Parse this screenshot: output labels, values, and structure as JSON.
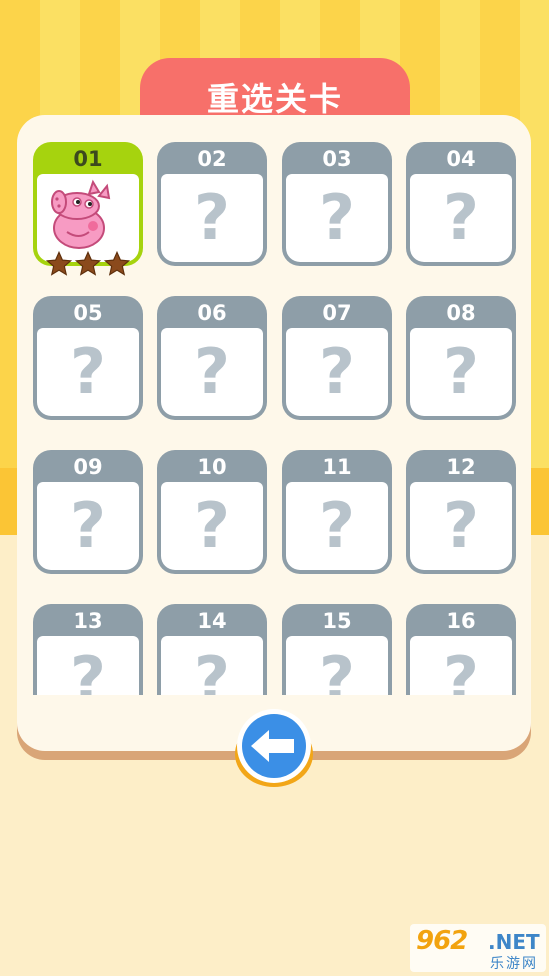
{
  "header": {
    "title": "重选关卡"
  },
  "levels": [
    {
      "num": "01",
      "unlocked": true,
      "stars": 3
    },
    {
      "num": "02",
      "q": "?"
    },
    {
      "num": "03",
      "q": "?"
    },
    {
      "num": "04",
      "q": "?"
    },
    {
      "num": "05",
      "q": "?"
    },
    {
      "num": "06",
      "q": "?"
    },
    {
      "num": "07",
      "q": "?"
    },
    {
      "num": "08",
      "q": "?"
    },
    {
      "num": "09",
      "q": "?"
    },
    {
      "num": "10",
      "q": "?"
    },
    {
      "num": "11",
      "q": "?"
    },
    {
      "num": "12",
      "q": "?"
    },
    {
      "num": "13",
      "q": "?"
    },
    {
      "num": "14",
      "q": "?"
    },
    {
      "num": "15",
      "q": "?"
    },
    {
      "num": "16",
      "q": "?"
    }
  ],
  "back_button": {
    "icon": "arrow-left-icon"
  },
  "watermark": {
    "number": "962",
    "suffix": ".NET",
    "cn": "乐游网"
  },
  "colors": {
    "accent": "#f7706a",
    "locked": "#8e9ea8",
    "unlocked": "#a6d30e",
    "star": "#8b4a1c",
    "back_button": "#3b8fe6"
  }
}
